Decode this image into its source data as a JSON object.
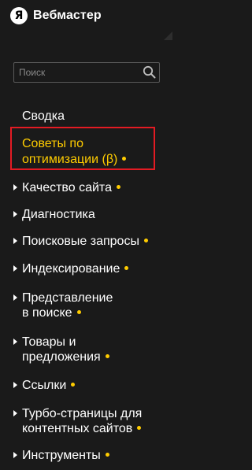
{
  "header": {
    "logo_letter": "Я",
    "title": "Вебмастер"
  },
  "search": {
    "placeholder": "Поиск",
    "value": ""
  },
  "colors": {
    "background": "#1a1a1a",
    "text": "#ffffff",
    "accent": "#ffcc00",
    "highlight_border": "#e31b23"
  },
  "menu": {
    "items": [
      {
        "id": "summary",
        "line1": "Сводка",
        "line2": ""
      },
      {
        "id": "optimization-tips",
        "line1": "Советы по",
        "line2": "оптимизации (β)"
      },
      {
        "id": "site-quality",
        "line1": "Качество сайта",
        "line2": ""
      },
      {
        "id": "diagnostics",
        "line1": "Диагностика",
        "line2": ""
      },
      {
        "id": "search-queries",
        "line1": "Поисковые запросы",
        "line2": ""
      },
      {
        "id": "indexing",
        "line1": "Индексирование",
        "line2": ""
      },
      {
        "id": "search-appearance",
        "line1": "Представление",
        "line2": "в поиске"
      },
      {
        "id": "products",
        "line1": "Товары и",
        "line2": "предложения"
      },
      {
        "id": "links",
        "line1": "Ссылки",
        "line2": ""
      },
      {
        "id": "turbo-pages",
        "line1": "Турбо-страницы для",
        "line2": "контентных сайтов"
      },
      {
        "id": "tools",
        "line1": "Инструменты",
        "line2": ""
      }
    ]
  }
}
